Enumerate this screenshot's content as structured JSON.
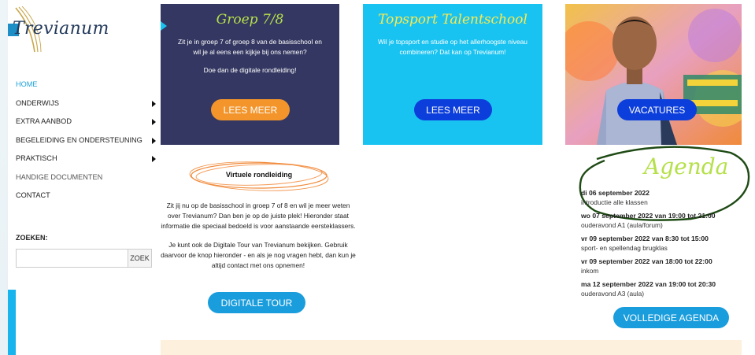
{
  "site": {
    "logo_text": "Trevianum"
  },
  "nav": {
    "items": [
      {
        "label": "HOME",
        "submenu": false,
        "active": true
      },
      {
        "label": "ONDERWIJS",
        "submenu": true
      },
      {
        "label": "EXTRA AANBOD",
        "submenu": true
      },
      {
        "label": "BEGELEIDING EN ONDERSTEUNING",
        "submenu": true
      },
      {
        "label": "PRAKTISCH",
        "submenu": true
      },
      {
        "label": "HANDIGE DOCUMENTEN",
        "submenu": false
      },
      {
        "label": "CONTACT",
        "submenu": false
      }
    ]
  },
  "search": {
    "label": "ZOEKEN:",
    "value": "",
    "button_label": "ZOEK"
  },
  "cards": {
    "groep": {
      "title": "Groep 7/8",
      "text": "Zit je in groep 7 of groep 8 van de basisschool en wil je al eens een kijkje bij ons nemen?",
      "text2": "Doe dan de digitale rondleiding!",
      "button_label": "LEES MEER"
    },
    "topsport": {
      "title": "Topsport Talentschool",
      "text": "Wil je topsport en studie op het allerhoogste niveau combineren? Dat kan op Trevianum!",
      "button_label": "LEES MEER"
    },
    "vacatures": {
      "button_label": "VACATURES"
    }
  },
  "tour": {
    "title": "Virtuele rondleiding",
    "paragraph1": "Zit jij nu op de basisschool in groep 7 of 8 en wil je meer weten over Trevianum? Dan ben je op de juiste plek! Hieronder staat informatie die speciaal bedoeld is voor aanstaande eersteklassers.",
    "paragraph2": "Je kunt ook de Digitale Tour van Trevianum bekijken. Gebruik daarvoor de knop hieronder - en als je nog vragen hebt, dan kun je altijd contact met ons opnemen!",
    "button_label": "DIGITALE TOUR"
  },
  "agenda": {
    "title": "Agenda",
    "events": [
      {
        "date": "di 06 september 2022",
        "desc": "introductie alle klassen"
      },
      {
        "date": "wo 07 september 2022 van 19:00 tot 21:00",
        "desc": "ouderavond A1 (aula/forum)"
      },
      {
        "date": "vr 09 september 2022 van 8:30 tot 15:00",
        "desc": "sport- en spellendag brugklas"
      },
      {
        "date": "vr 09 september 2022 van 18:00 tot 22:00",
        "desc": "inkom"
      },
      {
        "date": "ma 12 september 2022 van 19:00 tot 20:30",
        "desc": "ouderavond A3 (aula)"
      }
    ],
    "button_label": "VOLLEDIGE AGENDA"
  },
  "colors": {
    "navy_card": "#343761",
    "cyan_card": "#19c3f1",
    "orange_button": "#f3952a",
    "blue_button": "#0c3edb",
    "light_blue_button": "#1a9ddc",
    "lime_heading": "#b5e04a",
    "annotation_circle": "#1e4a14"
  }
}
